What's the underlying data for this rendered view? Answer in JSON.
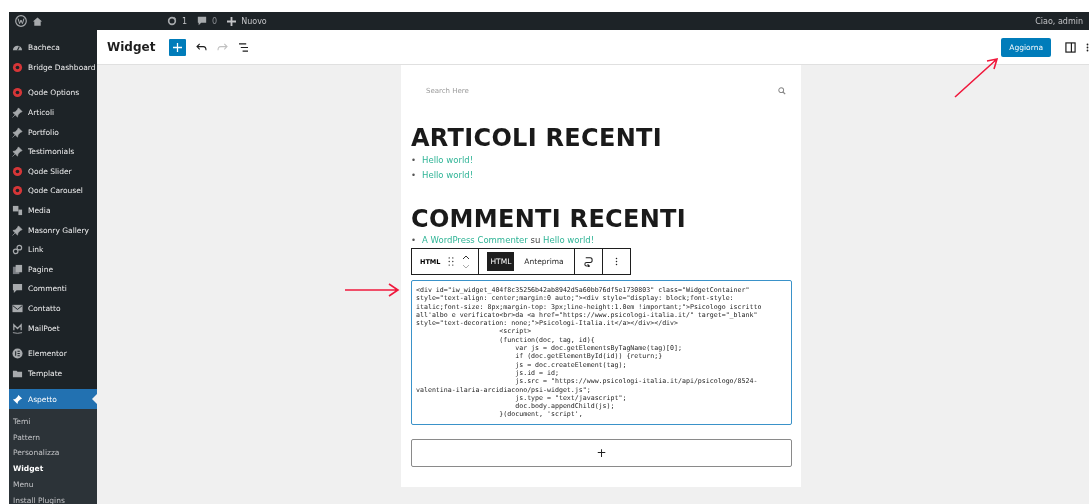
{
  "admin_bar": {
    "updates": "1",
    "comments": "0",
    "new_label": "Nuovo",
    "greeting": "Ciao, admin"
  },
  "sidebar": {
    "items": [
      {
        "label": "Bacheca",
        "selected": false
      },
      {
        "label": "Bridge Dashboard",
        "selected": false
      },
      {
        "label": "Qode Options",
        "selected": false
      },
      {
        "label": "Articoli",
        "selected": false
      },
      {
        "label": "Portfolio",
        "selected": false
      },
      {
        "label": "Testimonials",
        "selected": false
      },
      {
        "label": "Qode Slider",
        "selected": false
      },
      {
        "label": "Qode Carousel",
        "selected": false
      },
      {
        "label": "Media",
        "selected": false
      },
      {
        "label": "Masonry Gallery",
        "selected": false
      },
      {
        "label": "Link",
        "selected": false
      },
      {
        "label": "Pagine",
        "selected": false
      },
      {
        "label": "Commenti",
        "selected": false
      },
      {
        "label": "Contatto",
        "selected": false
      },
      {
        "label": "MailPoet",
        "selected": false
      },
      {
        "label": "Elementor",
        "selected": false
      },
      {
        "label": "Template",
        "selected": false
      },
      {
        "label": "Aspetto",
        "selected": true
      }
    ],
    "submenu": [
      {
        "label": "Temi",
        "selected": false
      },
      {
        "label": "Pattern",
        "selected": false
      },
      {
        "label": "Personalizza",
        "selected": false
      },
      {
        "label": "Widget",
        "selected": true
      },
      {
        "label": "Menu",
        "selected": false
      },
      {
        "label": "Install Plugins",
        "selected": false
      }
    ]
  },
  "header": {
    "title": "Widget",
    "update_button": "Aggiorna"
  },
  "canvas": {
    "search": {
      "placeholder": "Search Here"
    },
    "recent_posts": {
      "bullet": "•",
      "heading": "ARTICOLI RECENTI",
      "links": [
        "Hello world!",
        "Hello world!"
      ]
    },
    "recent_comments": {
      "bullet": "•",
      "heading": "COMMENTI RECENTI",
      "author": "A WordPress Commenter",
      "joiner": "su",
      "post": "Hello world!"
    },
    "block_toolbar": {
      "block_label": "HTML",
      "tabs": [
        {
          "label": "HTML",
          "selected": true
        },
        {
          "label": "Anteprima",
          "selected": false
        }
      ]
    },
    "code_lines": [
      "<div id=\"iw_widget_404f8c35256b42ab8942d5a60bb76df5e1730803\" class=\"WidgetContainer\"",
      "style=\"text-align: center;margin:0 auto;\"><div style=\"display: block;font-style:",
      "italic;font-size: 8px;margin-top: 3px;line-height:1.0em !important;\">Psicologo iscritto",
      "all'albo e verificato<br>da <a href=\"https://www.psicologi-italia.it/\" target=\"_blank\"",
      "style=\"text-decoration: none;\">Psicologi-Italia.it</a></div></div>",
      "                     <script>",
      "                     (function(doc, tag, id){",
      "                         var js = doc.getElementsByTagName(tag)[0];",
      "                         if (doc.getElementById(id)) {return;}",
      "                         js = doc.createElement(tag);",
      "                         js.id = id;",
      "                         js.src = \"https://www.psicologi-italia.it/api/psicologo/8524-",
      "valentina-ilaria-arcidiacono/psi-widget.js\";",
      "                         js.type = \"text/javascript\";",
      "                         doc.body.appendChild(js);",
      "                     }(document, 'script',"
    ],
    "add_block": "+"
  }
}
